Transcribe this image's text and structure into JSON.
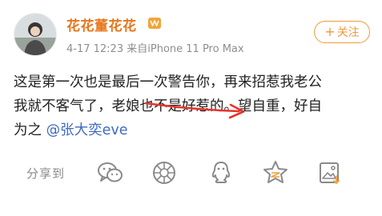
{
  "post": {
    "username": "花花董花花",
    "timestamp": "4-17 12:23",
    "source": "来自iPhone 11 Pro Max",
    "follow_label": "关注",
    "follow_plus": "+",
    "content": {
      "line1": "这是第一次也是最后一次警告你，再来招惹我老公",
      "line2": "我就不客气了，老娘也不是好惹的。望自重，好自",
      "line3_text": "为之 ",
      "mention": "@张大奕eve"
    }
  },
  "actions": {
    "share_label": "分享到",
    "icons": [
      "wechat-icon",
      "moments-icon",
      "qq-icon",
      "qzone-icon",
      "save-image-icon"
    ]
  },
  "colors": {
    "username": "#e8751a",
    "follow": "#f19a3a",
    "mention": "#3e6ac3",
    "arrow": "#e8332b",
    "icon": "#8a8a8a"
  }
}
